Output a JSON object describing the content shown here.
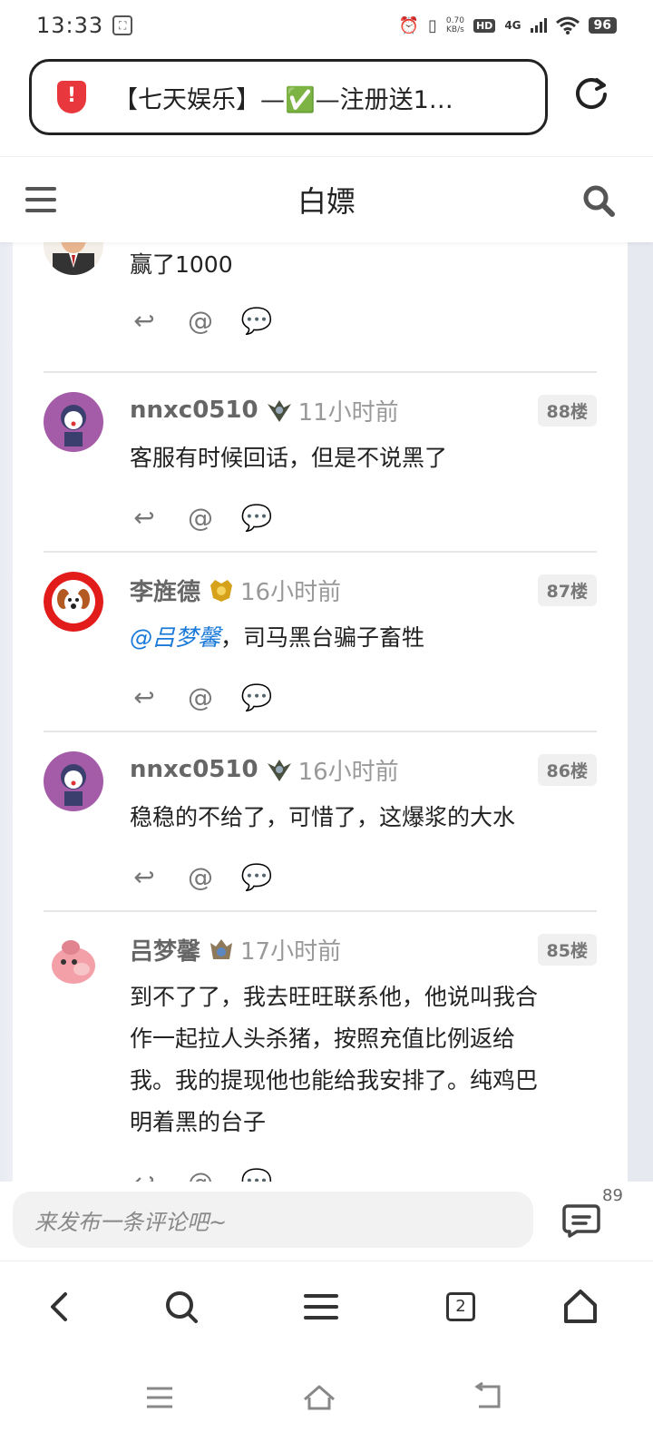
{
  "status_bar": {
    "time": "13:33",
    "net_speed_value": "0.70",
    "net_speed_unit": "KB/s",
    "hd_label": "HD",
    "network_label": "4G",
    "battery": "96"
  },
  "url_bar": {
    "title": "【七天娱乐】—✅—注册送1…"
  },
  "topnav": {
    "title": "白嫖"
  },
  "comments": [
    {
      "user": "",
      "time": "",
      "floor": "",
      "text": "赢了1000"
    },
    {
      "user": "nnxc0510",
      "time": "11小时前",
      "floor": "88楼",
      "text": "客服有时候回话，但是不说黑了"
    },
    {
      "user": "李旌德",
      "time": "16小时前",
      "floor": "87楼",
      "mention": "@吕梦馨",
      "text": "，司马黑台骗子畜牲"
    },
    {
      "user": "nnxc0510",
      "time": "16小时前",
      "floor": "86楼",
      "text": "稳稳的不给了，可惜了，这爆浆的大水"
    },
    {
      "user": "吕梦馨",
      "time": "17小时前",
      "floor": "85楼",
      "text_lines": [
        "到不了了，我去旺旺联系他，他说叫我合",
        "作一起拉人头杀猪，按照充值比例返给",
        "我。我的提现他也能给我安排了。纯鸡巴",
        "明着黑的台子"
      ]
    }
  ],
  "comment_bar": {
    "placeholder": "来发布一条评论吧~",
    "count": "89"
  },
  "browser_bar": {
    "tabs_count": "2"
  },
  "colors": {
    "mention": "#1a7ad9",
    "shield": "#e8383d",
    "floor_badge_bg": "#f0f0f0"
  }
}
